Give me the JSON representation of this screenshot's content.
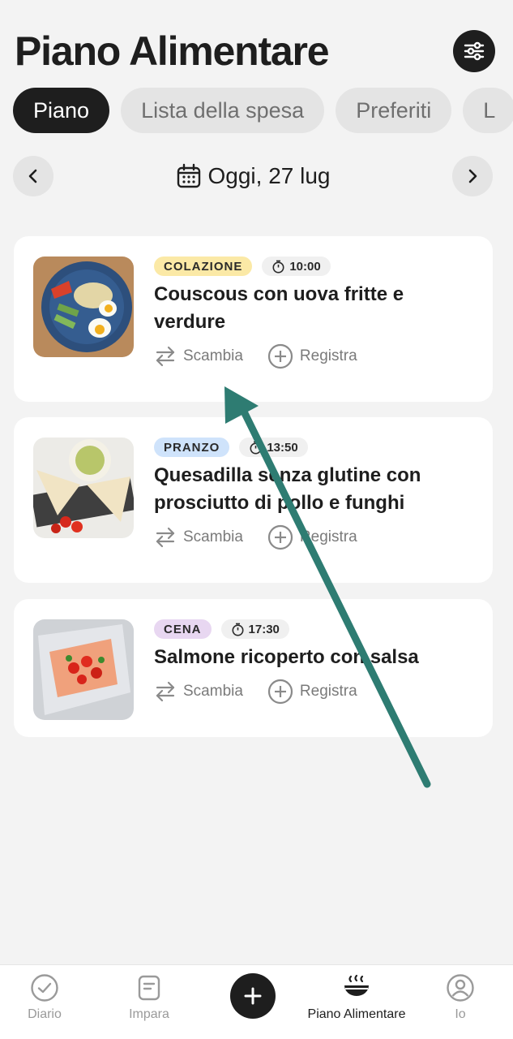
{
  "header": {
    "title": "Piano Alimentare"
  },
  "tabs": [
    "Piano",
    "Lista della spesa",
    "Preferiti",
    "L"
  ],
  "date": {
    "label": "Oggi, 27 lug"
  },
  "meals": [
    {
      "tag": "COLAZIONE",
      "time": "10:00",
      "title": "Couscous con uova fritte e verdure",
      "swap": "Scambia",
      "log": "Registra"
    },
    {
      "tag": "PRANZO",
      "time": "13:50",
      "title": "Quesadilla senza glutine con prosciutto di pollo e funghi",
      "swap": "Scambia",
      "log": "Registra"
    },
    {
      "tag": "CENA",
      "time": "17:30",
      "title": "Salmone ricoperto con salsa",
      "swap": "Scambia",
      "log": "Registra"
    }
  ],
  "bottom_nav": [
    {
      "label": "Diario"
    },
    {
      "label": "Impara"
    },
    {
      "label": "Piano Alimentare"
    },
    {
      "label": "Io"
    }
  ],
  "colors": {
    "dark": "#1e1e1e",
    "background": "#f3f3f3",
    "arrow": "#2e7c72",
    "colazione": "#fbe9a6",
    "pranzo": "#cfe3fb",
    "cena": "#e8d7f1"
  }
}
